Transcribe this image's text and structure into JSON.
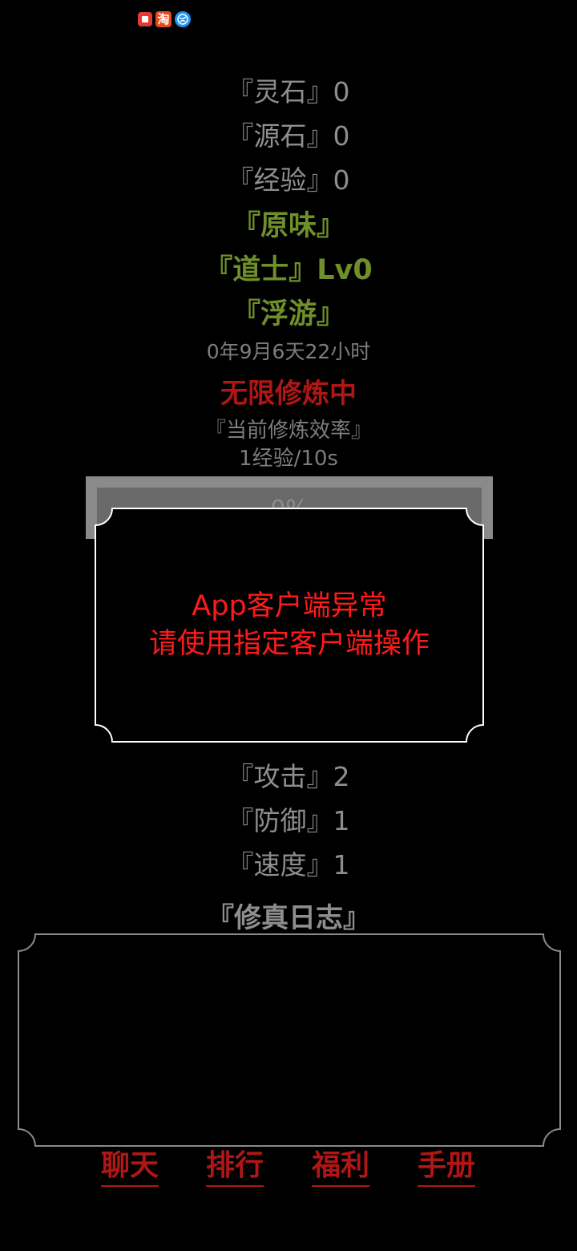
{
  "status_bar": {
    "icons": [
      "book-app-icon",
      "taobao-icon",
      "browser-globe-icon"
    ],
    "taobao_glyph": "淘"
  },
  "resources": {
    "spirit_stone": "『灵石』0",
    "source_stone": "『源石』0",
    "experience": "『经验』0"
  },
  "character": {
    "name": "『原味』",
    "profession": "『道士』Lv0",
    "realm": "『浮游』"
  },
  "age": "0年9月6天22小时",
  "cultivation_status": "无限修炼中",
  "efficiency": {
    "label": "『当前修炼效率』",
    "value": "1经验/10s"
  },
  "progress": {
    "percent": 0,
    "text": "0%"
  },
  "modal": {
    "line1": "App客户端异常",
    "line2": "请使用指定客户端操作"
  },
  "combat_stats": {
    "attack": "『攻击』2",
    "defense": "『防御』1",
    "speed": "『速度』1"
  },
  "log": {
    "title": "『修真日志』"
  },
  "nav": {
    "chat": "聊天",
    "ranking": "排行",
    "welfare": "福利",
    "manual": "手册"
  },
  "colors": {
    "background": "#000000",
    "gray_text": "#8e8e8e",
    "green_text": "#6f8f2a",
    "red_text": "#b01616",
    "alert_red": "#ff1a1a"
  }
}
